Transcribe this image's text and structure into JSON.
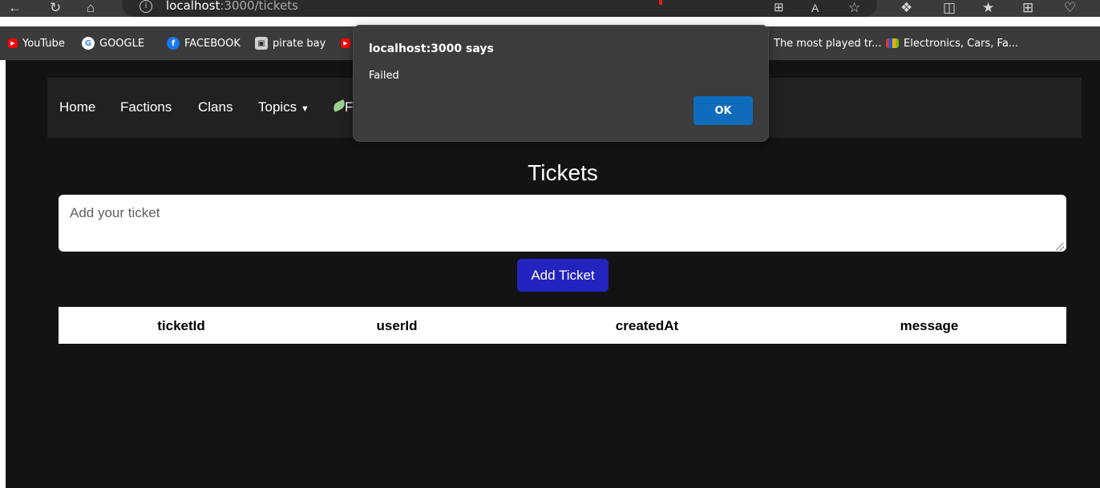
{
  "browser": {
    "url_host": "localhost",
    "url_path": ":3000/tickets",
    "icons": [
      "back-arrow-icon",
      "refresh-icon",
      "home-icon",
      "info-icon",
      "split-screen-icon",
      "read-aloud-icon",
      "favorite-star-icon",
      "extensions-icon",
      "split-view-icon",
      "favorites-icon",
      "collections-icon",
      "performance-icon"
    ]
  },
  "bookmarks": [
    {
      "label": "YouTube",
      "icon": "youtube-icon",
      "color": "#ff0000"
    },
    {
      "label": "GOOGLE",
      "icon": "google-icon",
      "color": "#4285f4"
    },
    {
      "label": "FACEBOOK",
      "icon": "facebook-icon",
      "color": "#1877f2"
    },
    {
      "label": "pirate bay",
      "icon": "pirate-bay-icon",
      "color": "#cfcfcf"
    },
    {
      "label": "The most played tr...",
      "icon": "bookmark-icon",
      "color": "#ff0000"
    },
    {
      "label": "Electronics, Cars, Fa...",
      "icon": "ebay-icon",
      "color": "#e53238"
    }
  ],
  "nav": {
    "items": [
      "Home",
      "Factions",
      "Clans",
      "Topics"
    ],
    "cut_text": "F"
  },
  "main": {
    "title": "Tickets",
    "input_placeholder": "Add your ticket",
    "add_button_label": "Add Ticket",
    "table_headers": [
      "ticketId",
      "userId",
      "createdAt",
      "message"
    ]
  },
  "alert": {
    "title": "localhost:3000 says",
    "message": "Failed",
    "ok_label": "OK"
  }
}
